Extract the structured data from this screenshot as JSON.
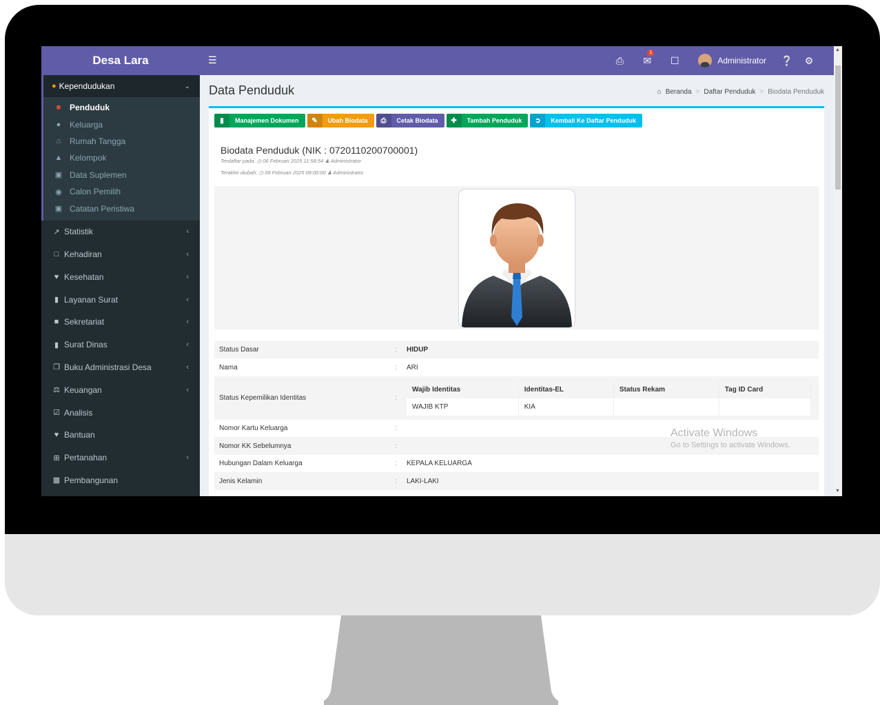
{
  "sidebar": {
    "brand": "Desa Lara",
    "group": {
      "label": "Kependudukan",
      "caret": "⌄"
    },
    "subitems": [
      {
        "label": "Penduduk",
        "icon": "user-icon"
      },
      {
        "label": "Keluarga",
        "icon": "users-icon"
      },
      {
        "label": "Rumah Tangga",
        "icon": "house-icon"
      },
      {
        "label": "Kelompok",
        "icon": "sitemap-icon"
      },
      {
        "label": "Data Suplemen",
        "icon": "archive-icon"
      },
      {
        "label": "Calon Pemilih",
        "icon": "map-pin-icon"
      },
      {
        "label": "Catatan Peristiwa",
        "icon": "archive-box-icon"
      }
    ],
    "items": [
      {
        "label": "Statistik",
        "arrow": "‹"
      },
      {
        "label": "Kehadiran",
        "arrow": "‹"
      },
      {
        "label": "Kesehatan",
        "arrow": "‹"
      },
      {
        "label": "Layanan Surat",
        "arrow": "‹"
      },
      {
        "label": "Sekretariat",
        "arrow": "‹"
      },
      {
        "label": "Surat Dinas",
        "arrow": "‹"
      },
      {
        "label": "Buku Administrasi Desa",
        "arrow": "‹"
      },
      {
        "label": "Keuangan",
        "arrow": "‹"
      },
      {
        "label": "Analisis",
        "arrow": ""
      },
      {
        "label": "Bantuan",
        "arrow": ""
      },
      {
        "label": "Pertanahan",
        "arrow": "‹"
      },
      {
        "label": "Pembangunan",
        "arrow": ""
      }
    ]
  },
  "topbar": {
    "notification_count": "1",
    "user_name": "Administrator"
  },
  "page": {
    "title": "Data Penduduk",
    "breadcrumb": [
      "Beranda",
      "Daftar Penduduk",
      "Biodata Penduduk"
    ],
    "buttons": [
      {
        "label": "Manajemen Dokumen",
        "color": "#00a65a"
      },
      {
        "label": "Ubah Biodata",
        "color": "#f39c12"
      },
      {
        "label": "Cetak Biodata",
        "color": "#605ca8"
      },
      {
        "label": "Tambah Penduduk",
        "color": "#00a65a"
      },
      {
        "label": "Kembali Ke Daftar Penduduk",
        "color": "#00c0ef"
      }
    ],
    "biodata_title": "Biodata Penduduk (NIK : 0720110200700001)",
    "registered": {
      "prefix": "Terdaftar pada:",
      "time": "06 Februari 2025 11:58:54",
      "by": "Administrator"
    },
    "modified": {
      "prefix": "Terakhir diubah:",
      "time": "09 Februari 2025 09:00:00",
      "by": "Administrator"
    }
  },
  "details": {
    "status_dasar": {
      "label": "Status Dasar",
      "value": "HIDUP"
    },
    "nama": {
      "label": "Nama",
      "value": "ARI"
    },
    "kepemilikan": {
      "label": "Status Kepemilikan Identitas",
      "headers": [
        "Wajib Identitas",
        "Identitas-EL",
        "Status Rekam",
        "Tag ID Card"
      ],
      "values": [
        "WAJIB KTP",
        "KIA",
        "",
        ""
      ]
    },
    "kk": {
      "label": "Nomor Kartu Keluarga",
      "value": ""
    },
    "kk_sebelumnya": {
      "label": "Nomor KK Sebelumnya",
      "value": ""
    },
    "hubungan": {
      "label": "Hubungan Dalam Keluarga",
      "value": "KEPALA KELUARGA"
    },
    "jenis_kelamin": {
      "label": "Jenis Kelamin",
      "value": "LAKI-LAKI"
    }
  },
  "watermark": {
    "title": "Activate Windows",
    "subtitle": "Go to Settings to activate Windows."
  },
  "colors": {
    "accent": "#605ca8",
    "sidebar": "#222d32",
    "info": "#00c0ef",
    "success": "#00a65a",
    "warning": "#f39c12"
  }
}
